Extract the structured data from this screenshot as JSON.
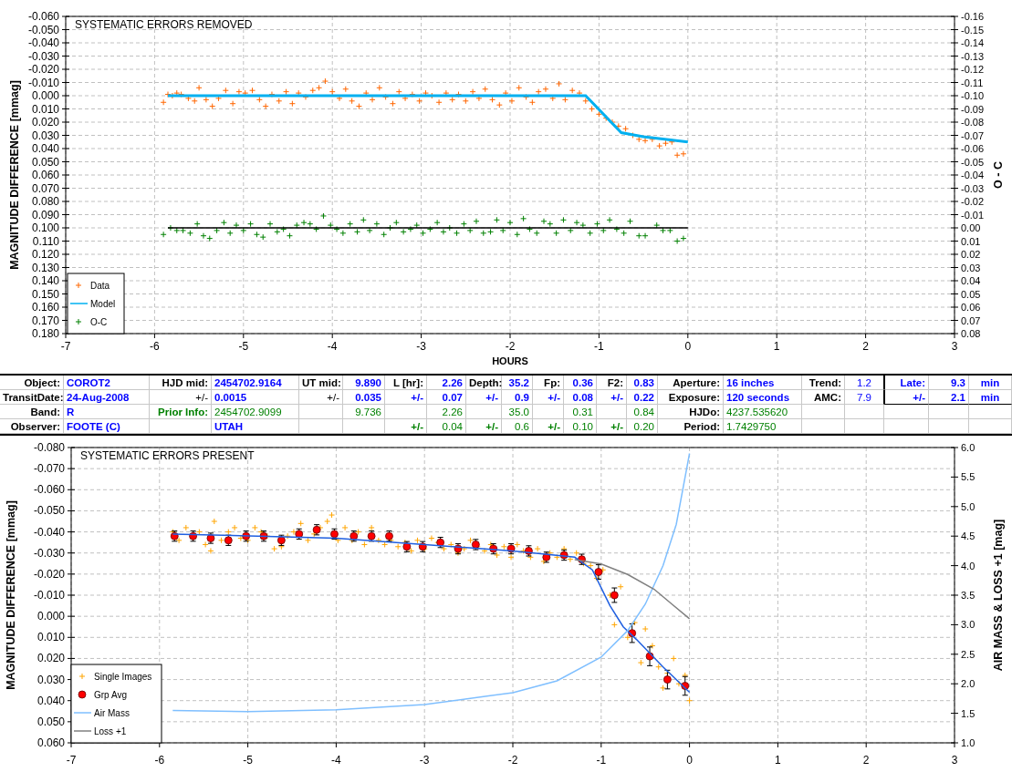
{
  "top_chart": {
    "chart_data": {
      "type": "scatter",
      "title": "SYSTEMATIC ERRORS REMOVED",
      "grid": true,
      "legend": true,
      "xlabel": "HOURS",
      "ylabel": "MAGNITUDE DIFFERENCE [mmag]",
      "y2label": "O - C",
      "xlim": [
        -7,
        3
      ],
      "ylim": [
        0.18,
        -0.06
      ],
      "y2lim": [
        0.08,
        -0.16
      ],
      "xticks": [
        {
          "value": -7,
          "label": "-7"
        },
        {
          "value": -6,
          "label": "-6"
        },
        {
          "value": -5,
          "label": "-5"
        },
        {
          "value": -4,
          "label": "-4"
        },
        {
          "value": -3,
          "label": "-3"
        },
        {
          "value": -2,
          "label": "-2"
        },
        {
          "value": -1,
          "label": "-1"
        },
        {
          "value": 0,
          "label": "0"
        },
        {
          "value": 1,
          "label": "1"
        },
        {
          "value": 2,
          "label": "2"
        },
        {
          "value": 3,
          "label": "3"
        }
      ],
      "yticks": [
        {
          "value": -0.06,
          "label": "-0.060"
        },
        {
          "value": -0.05,
          "label": "-0.050"
        },
        {
          "value": -0.04,
          "label": "-0.040"
        },
        {
          "value": -0.03,
          "label": "-0.030"
        },
        {
          "value": -0.02,
          "label": "-0.020"
        },
        {
          "value": -0.01,
          "label": "-0.010"
        },
        {
          "value": 0,
          "label": "0.000"
        },
        {
          "value": 0.01,
          "label": "0.010"
        },
        {
          "value": 0.02,
          "label": "0.020"
        },
        {
          "value": 0.03,
          "label": "0.030"
        },
        {
          "value": 0.04,
          "label": "0.040"
        },
        {
          "value": 0.05,
          "label": "0.050"
        },
        {
          "value": 0.06,
          "label": "0.060"
        },
        {
          "value": 0.07,
          "label": "0.070"
        },
        {
          "value": 0.08,
          "label": "0.080"
        },
        {
          "value": 0.09,
          "label": "0.090"
        },
        {
          "value": 0.1,
          "label": "0.100"
        },
        {
          "value": 0.11,
          "label": "0.110"
        },
        {
          "value": 0.12,
          "label": "0.120"
        },
        {
          "value": 0.13,
          "label": "0.130"
        },
        {
          "value": 0.14,
          "label": "0.140"
        },
        {
          "value": 0.15,
          "label": "0.150"
        },
        {
          "value": 0.16,
          "label": "0.160"
        },
        {
          "value": 0.17,
          "label": "0.170"
        },
        {
          "value": 0.18,
          "label": "0.180"
        }
      ],
      "y2ticks": [
        {
          "value": -0.16,
          "label": "-0.16"
        },
        {
          "value": -0.15,
          "label": "-0.15"
        },
        {
          "value": -0.14,
          "label": "-0.14"
        },
        {
          "value": -0.13,
          "label": "-0.13"
        },
        {
          "value": -0.12,
          "label": "-0.12"
        },
        {
          "value": -0.11,
          "label": "-0.11"
        },
        {
          "value": -0.1,
          "label": "-0.10"
        },
        {
          "value": -0.09,
          "label": "-0.09"
        },
        {
          "value": -0.08,
          "label": "-0.08"
        },
        {
          "value": -0.07,
          "label": "-0.07"
        },
        {
          "value": -0.06,
          "label": "-0.06"
        },
        {
          "value": -0.05,
          "label": "-0.05"
        },
        {
          "value": -0.04,
          "label": "-0.04"
        },
        {
          "value": -0.03,
          "label": "-0.03"
        },
        {
          "value": -0.02,
          "label": "-0.02"
        },
        {
          "value": -0.01,
          "label": "-0.01"
        },
        {
          "value": 0,
          "label": "0.00"
        },
        {
          "value": 0.01,
          "label": "0.01"
        },
        {
          "value": 0.02,
          "label": "0.02"
        },
        {
          "value": 0.03,
          "label": "0.03"
        },
        {
          "value": 0.04,
          "label": "0.04"
        },
        {
          "value": 0.05,
          "label": "0.05"
        },
        {
          "value": 0.06,
          "label": "0.06"
        },
        {
          "value": 0.07,
          "label": "0.07"
        },
        {
          "value": 0.08,
          "label": "0.08"
        }
      ],
      "series": [
        {
          "name": "Data",
          "type": "scatter",
          "marker": "plus",
          "color": "#ff6600",
          "x": [
            -5.9,
            -5.85,
            -5.8,
            -5.75,
            -5.7,
            -5.62,
            -5.55,
            -5.5,
            -5.42,
            -5.35,
            -5.28,
            -5.2,
            -5.12,
            -5.05,
            -4.98,
            -4.9,
            -4.82,
            -4.75,
            -4.68,
            -4.6,
            -4.52,
            -4.45,
            -4.38,
            -4.3,
            -4.22,
            -4.15,
            -4.08,
            -4.0,
            -3.92,
            -3.85,
            -3.78,
            -3.7,
            -3.62,
            -3.55,
            -3.47,
            -3.4,
            -3.32,
            -3.25,
            -3.18,
            -3.1,
            -3.02,
            -2.95,
            -2.88,
            -2.8,
            -2.72,
            -2.65,
            -2.58,
            -2.5,
            -2.42,
            -2.35,
            -2.28,
            -2.2,
            -2.12,
            -2.05,
            -1.98,
            -1.9,
            -1.82,
            -1.75,
            -1.68,
            -1.6,
            -1.52,
            -1.45,
            -1.38,
            -1.3,
            -1.22,
            -1.15,
            -1.08,
            -1.0,
            -0.92,
            -0.85,
            -0.78,
            -0.7,
            -0.62,
            -0.55,
            -0.48,
            -0.4,
            -0.32,
            -0.25,
            -0.18,
            -0.12,
            -0.05
          ],
          "values": [
            0.005,
            -0.001,
            0.0,
            -0.002,
            -0.001,
            0.002,
            0.004,
            -0.006,
            0.003,
            0.008,
            0.002,
            -0.004,
            0.006,
            -0.003,
            -0.002,
            -0.004,
            0.003,
            0.008,
            -0.001,
            0.004,
            -0.003,
            0.006,
            -0.002,
            0.001,
            -0.004,
            -0.006,
            -0.011,
            -0.003,
            0.002,
            -0.005,
            0.004,
            0.008,
            -0.002,
            0.003,
            -0.006,
            0.001,
            0.006,
            -0.003,
            0.002,
            -0.001,
            0.004,
            -0.002,
            0.0,
            0.005,
            -0.002,
            0.003,
            -0.001,
            0.004,
            -0.003,
            0.002,
            -0.005,
            0.003,
            0.007,
            -0.002,
            0.004,
            -0.006,
            0.001,
            0.005,
            -0.003,
            -0.005,
            0.002,
            -0.009,
            0.003,
            -0.004,
            -0.002,
            0.004,
            0.01,
            0.014,
            0.017,
            0.02,
            0.023,
            0.025,
            0.03,
            0.033,
            0.034,
            0.033,
            0.038,
            0.036,
            0.035,
            0.045,
            0.044
          ]
        },
        {
          "name": "Model",
          "type": "line",
          "color": "#00b0f0",
          "x": [
            -5.85,
            -1.15,
            -0.75,
            -0.5,
            0
          ],
          "values": [
            0.0,
            0.0,
            0.028,
            0.031,
            0.035
          ]
        },
        {
          "name": "O-C",
          "type": "scatter",
          "marker": "plus",
          "axis": "y2",
          "color": "#008000",
          "x": [
            -5.9,
            -5.82,
            -5.75,
            -5.68,
            -5.6,
            -5.52,
            -5.45,
            -5.38,
            -5.3,
            -5.22,
            -5.15,
            -5.08,
            -5.0,
            -4.92,
            -4.85,
            -4.78,
            -4.7,
            -4.62,
            -4.55,
            -4.48,
            -4.4,
            -4.32,
            -4.25,
            -4.18,
            -4.1,
            -4.02,
            -3.95,
            -3.88,
            -3.8,
            -3.72,
            -3.65,
            -3.58,
            -3.5,
            -3.42,
            -3.35,
            -3.28,
            -3.2,
            -3.12,
            -3.05,
            -2.98,
            -2.9,
            -2.82,
            -2.75,
            -2.68,
            -2.6,
            -2.52,
            -2.45,
            -2.38,
            -2.3,
            -2.22,
            -2.15,
            -2.08,
            -2.0,
            -1.92,
            -1.85,
            -1.78,
            -1.7,
            -1.62,
            -1.55,
            -1.48,
            -1.4,
            -1.32,
            -1.25,
            -1.18,
            -1.1,
            -1.02,
            -0.95,
            -0.88,
            -0.8,
            -0.72,
            -0.65,
            -0.55,
            -0.48,
            -0.35,
            -0.28,
            -0.2,
            -0.12,
            -0.05
          ],
          "values": [
            0.005,
            0.0,
            0.002,
            0.002,
            0.004,
            -0.003,
            0.006,
            0.008,
            0.002,
            -0.004,
            0.004,
            -0.002,
            0.002,
            -0.003,
            0.005,
            0.007,
            -0.003,
            0.003,
            0.001,
            0.006,
            -0.002,
            -0.004,
            -0.003,
            0.001,
            -0.009,
            -0.002,
            0.001,
            0.004,
            -0.003,
            0.003,
            -0.006,
            0.002,
            -0.003,
            0.005,
            0.0,
            -0.004,
            0.003,
            0.001,
            -0.002,
            0.004,
            0.001,
            -0.004,
            0.003,
            0.0,
            0.004,
            -0.003,
            0.002,
            -0.005,
            0.004,
            0.003,
            -0.006,
            0.002,
            -0.004,
            0.005,
            -0.007,
            0.001,
            0.004,
            -0.005,
            -0.003,
            0.004,
            -0.006,
            0.002,
            -0.004,
            -0.002,
            0.004,
            -0.003,
            0.002,
            -0.006,
            0.001,
            0.004,
            -0.005,
            0.006,
            0.006,
            -0.002,
            0.002,
            0.002,
            0.01,
            0.008
          ]
        },
        {
          "type": "line",
          "axis": "y2",
          "color": "#000000",
          "x": [
            -5.85,
            0
          ],
          "values": [
            0,
            0
          ]
        }
      ]
    }
  },
  "parameter_table": {
    "rows": [
      {
        "cells": [
          {
            "text": "Object:",
            "kind": "label"
          },
          {
            "text": "COROT2",
            "kind": "value"
          },
          {
            "text": "HJD mid:",
            "kind": "label"
          },
          {
            "text": "2454702.9164",
            "kind": "value"
          },
          {
            "text": "UT mid:",
            "kind": "label"
          },
          {
            "text": "9.890",
            "kind": "value"
          },
          {
            "text": "L [hr]:",
            "kind": "label"
          },
          {
            "text": "2.26",
            "kind": "value"
          },
          {
            "text": "Depth:",
            "kind": "label"
          },
          {
            "text": "35.2",
            "kind": "value"
          },
          {
            "text": "Fp:",
            "kind": "label"
          },
          {
            "text": "0.36",
            "kind": "value"
          },
          {
            "text": "F2:",
            "kind": "label"
          },
          {
            "text": "0.83",
            "kind": "value"
          },
          {
            "text": "Aperture:",
            "kind": "label"
          },
          {
            "text": "16 inches",
            "kind": "value"
          },
          {
            "text": "Trend:",
            "kind": "label"
          },
          {
            "text": "1.2",
            "kind": "setting"
          },
          {
            "text": "Late:",
            "kind": "value"
          },
          {
            "text": "9.3",
            "kind": "value"
          },
          {
            "text": "min",
            "kind": "value"
          }
        ]
      },
      {
        "cells": [
          {
            "text": "TransitDate:",
            "kind": "label"
          },
          {
            "text": "24-Aug-2008",
            "kind": "value"
          },
          {
            "text": "+/-",
            "kind": "plain"
          },
          {
            "text": "0.0015",
            "kind": "value"
          },
          {
            "text": "+/-",
            "kind": "plain"
          },
          {
            "text": "0.035",
            "kind": "value"
          },
          {
            "text": "+/-",
            "kind": "value"
          },
          {
            "text": "0.07",
            "kind": "value"
          },
          {
            "text": "+/-",
            "kind": "value"
          },
          {
            "text": "0.9",
            "kind": "value"
          },
          {
            "text": "+/-",
            "kind": "value"
          },
          {
            "text": "0.08",
            "kind": "value"
          },
          {
            "text": "+/-",
            "kind": "value"
          },
          {
            "text": "0.22",
            "kind": "value"
          },
          {
            "text": "Exposure:",
            "kind": "label"
          },
          {
            "text": "120 seconds",
            "kind": "value"
          },
          {
            "text": "AMC:",
            "kind": "label"
          },
          {
            "text": "7.9",
            "kind": "setting"
          },
          {
            "text": "+/-",
            "kind": "value"
          },
          {
            "text": "2.1",
            "kind": "value"
          },
          {
            "text": "min",
            "kind": "value"
          }
        ]
      },
      {
        "cells": [
          {
            "text": "Band:",
            "kind": "label"
          },
          {
            "text": "R",
            "kind": "value"
          },
          {
            "text": "Prior Info:",
            "kind": "prior-label"
          },
          {
            "text": "2454702.9099",
            "kind": "prior"
          },
          null,
          {
            "text": "9.736",
            "kind": "prior"
          },
          null,
          {
            "text": "2.26",
            "kind": "prior"
          },
          null,
          {
            "text": "35.0",
            "kind": "prior"
          },
          null,
          {
            "text": "0.31",
            "kind": "prior"
          },
          null,
          {
            "text": "0.84",
            "kind": "prior"
          },
          {
            "text": "HJDo:",
            "kind": "label"
          },
          {
            "text": "4237.535620",
            "kind": "prior"
          },
          null,
          null,
          null,
          null,
          null
        ]
      },
      {
        "cells": [
          {
            "text": "Observer:",
            "kind": "label"
          },
          {
            "text": "FOOTE (C)",
            "kind": "value"
          },
          null,
          {
            "text": "UTAH",
            "kind": "value"
          },
          null,
          null,
          {
            "text": "+/-",
            "kind": "prior-label"
          },
          {
            "text": "0.04",
            "kind": "prior"
          },
          {
            "text": "+/-",
            "kind": "prior-label"
          },
          {
            "text": "0.6",
            "kind": "prior"
          },
          {
            "text": "+/-",
            "kind": "prior-label"
          },
          {
            "text": "0.10",
            "kind": "prior"
          },
          {
            "text": "+/-",
            "kind": "prior-label"
          },
          {
            "text": "0.20",
            "kind": "prior"
          },
          {
            "text": "Period:",
            "kind": "label"
          },
          {
            "text": "1.7429750",
            "kind": "prior"
          },
          null,
          null,
          null,
          null,
          null
        ]
      }
    ]
  },
  "bottom_chart": {
    "chart_data": {
      "type": "scatter",
      "title": "SYSTEMATIC ERRORS PRESENT",
      "grid": true,
      "legend": true,
      "ylabel": "MAGNITUDE DIFFERENCE [mmag]",
      "y2label": "AIR MASS & LOSS +1 [mag]",
      "xlim": [
        -7,
        3
      ],
      "ylim": [
        0.06,
        -0.08
      ],
      "y2lim": [
        1,
        6
      ],
      "xticks": [
        {
          "value": -7,
          "label": "-7"
        },
        {
          "value": -6,
          "label": "-6"
        },
        {
          "value": -5,
          "label": "-5"
        },
        {
          "value": -4,
          "label": "-4"
        },
        {
          "value": -3,
          "label": "-3"
        },
        {
          "value": -2,
          "label": "-2"
        },
        {
          "value": -1,
          "label": "-1"
        },
        {
          "value": 0,
          "label": "0"
        },
        {
          "value": 1,
          "label": "1"
        },
        {
          "value": 2,
          "label": "2"
        },
        {
          "value": 3,
          "label": "3"
        }
      ],
      "yticks": [
        {
          "value": -0.08,
          "label": "-0.080"
        },
        {
          "value": -0.07,
          "label": "-0.070"
        },
        {
          "value": -0.06,
          "label": "-0.060"
        },
        {
          "value": -0.05,
          "label": "-0.050"
        },
        {
          "value": -0.04,
          "label": "-0.040"
        },
        {
          "value": -0.03,
          "label": "-0.030"
        },
        {
          "value": -0.02,
          "label": "-0.020"
        },
        {
          "value": -0.01,
          "label": "-0.010"
        },
        {
          "value": 0,
          "label": "0.000"
        },
        {
          "value": 0.01,
          "label": "0.010"
        },
        {
          "value": 0.02,
          "label": "0.020"
        },
        {
          "value": 0.03,
          "label": "0.030"
        },
        {
          "value": 0.04,
          "label": "0.040"
        },
        {
          "value": 0.05,
          "label": "0.050"
        },
        {
          "value": 0.06,
          "label": "0.060"
        }
      ],
      "y2ticks": [
        {
          "value": 6,
          "label": "6.0"
        },
        {
          "value": 5.5,
          "label": "5.5"
        },
        {
          "value": 5,
          "label": "5.0"
        },
        {
          "value": 4.5,
          "label": "4.5"
        },
        {
          "value": 4,
          "label": "4.0"
        },
        {
          "value": 3.5,
          "label": "3.5"
        },
        {
          "value": 3,
          "label": "3.0"
        },
        {
          "value": 2.5,
          "label": "2.5"
        },
        {
          "value": 2,
          "label": "2.0"
        },
        {
          "value": 1.5,
          "label": "1.5"
        },
        {
          "value": 1,
          "label": "1.0"
        }
      ],
      "series": [
        {
          "name": "Single Images",
          "type": "scatter",
          "marker": "plus",
          "color": "#ffa500",
          "x": [
            -5.85,
            -5.78,
            -5.7,
            -5.62,
            -5.55,
            -5.48,
            -5.42,
            -5.38,
            -5.3,
            -5.22,
            -5.15,
            -5.08,
            -5.0,
            -4.92,
            -4.85,
            -4.78,
            -4.7,
            -4.62,
            -4.55,
            -4.48,
            -4.4,
            -4.32,
            -4.25,
            -4.18,
            -4.1,
            -4.05,
            -3.98,
            -3.9,
            -3.82,
            -3.75,
            -3.68,
            -3.6,
            -3.52,
            -3.45,
            -3.38,
            -3.3,
            -3.22,
            -3.15,
            -3.08,
            -3.0,
            -2.92,
            -2.85,
            -2.78,
            -2.7,
            -2.62,
            -2.55,
            -2.48,
            -2.4,
            -2.32,
            -2.25,
            -2.18,
            -2.1,
            -2.02,
            -1.95,
            -1.88,
            -1.8,
            -1.72,
            -1.65,
            -1.58,
            -1.5,
            -1.42,
            -1.35,
            -1.28,
            -1.2,
            -1.12,
            -1.05,
            -0.98,
            -0.9,
            -0.85,
            -0.78,
            -0.7,
            -0.62,
            -0.55,
            -0.5,
            -0.42,
            -0.35,
            -0.3,
            -0.25,
            -0.18,
            -0.12,
            -0.05,
            0.0
          ],
          "values": [
            -0.04,
            -0.036,
            -0.042,
            -0.037,
            -0.04,
            -0.034,
            -0.031,
            -0.045,
            -0.036,
            -0.04,
            -0.042,
            -0.037,
            -0.036,
            -0.042,
            -0.04,
            -0.038,
            -0.032,
            -0.033,
            -0.038,
            -0.04,
            -0.044,
            -0.036,
            -0.039,
            -0.042,
            -0.045,
            -0.048,
            -0.036,
            -0.042,
            -0.036,
            -0.04,
            -0.034,
            -0.042,
            -0.036,
            -0.034,
            -0.036,
            -0.033,
            -0.035,
            -0.031,
            -0.036,
            -0.032,
            -0.037,
            -0.035,
            -0.032,
            -0.034,
            -0.03,
            -0.032,
            -0.036,
            -0.033,
            -0.031,
            -0.034,
            -0.029,
            -0.033,
            -0.028,
            -0.034,
            -0.031,
            -0.028,
            -0.032,
            -0.026,
            -0.03,
            -0.028,
            -0.032,
            -0.027,
            -0.03,
            -0.025,
            -0.024,
            -0.018,
            -0.022,
            -0.01,
            0.004,
            -0.014,
            0.01,
            0.003,
            0.022,
            0.006,
            0.014,
            0.024,
            0.034,
            0.027,
            0.02,
            0.032,
            0.028,
            0.04
          ]
        },
        {
          "name": "Grp Avg",
          "type": "scatter",
          "marker": "circle",
          "color": "#ff0000",
          "x": [
            -5.83,
            -5.62,
            -5.42,
            -5.22,
            -5.02,
            -4.82,
            -4.62,
            -4.42,
            -4.22,
            -4.02,
            -3.8,
            -3.6,
            -3.4,
            -3.2,
            -3.02,
            -2.82,
            -2.62,
            -2.42,
            -2.22,
            -2.02,
            -1.82,
            -1.62,
            -1.42,
            -1.22,
            -1.03,
            -0.85,
            -0.65,
            -0.45,
            -0.25,
            -0.05
          ],
          "values": [
            -0.038,
            -0.038,
            -0.037,
            -0.036,
            -0.038,
            -0.038,
            -0.036,
            -0.039,
            -0.041,
            -0.039,
            -0.038,
            -0.038,
            -0.038,
            -0.033,
            -0.033,
            -0.035,
            -0.032,
            -0.034,
            -0.032,
            -0.032,
            -0.031,
            -0.028,
            -0.029,
            -0.027,
            -0.021,
            -0.01,
            0.008,
            0.019,
            0.03,
            0.033
          ],
          "errors": [
            0.002,
            0.002,
            0.002,
            0.002,
            0.002,
            0.002,
            0.002,
            0.002,
            0.002,
            0.002,
            0.002,
            0.002,
            0.002,
            0.002,
            0.002,
            0.002,
            0.002,
            0.002,
            0.002,
            0.002,
            0.002,
            0.002,
            0.002,
            0.002,
            0.003,
            0.003,
            0.004,
            0.004,
            0.004,
            0.004
          ]
        },
        {
          "type": "line",
          "color": "#1f5fe0",
          "x": [
            -5.85,
            -4,
            -3,
            -2,
            -1.3,
            -1.1,
            -0.9,
            -0.75,
            -0.6,
            -0.3,
            0
          ],
          "values": [
            -0.039,
            -0.037,
            -0.034,
            -0.031,
            -0.028,
            -0.022,
            -0.005,
            0.005,
            0.011,
            0.024,
            0.036
          ]
        },
        {
          "name": "Air Mass",
          "type": "line",
          "axis": "y2",
          "color": "#7fbfff",
          "x": [
            -5.85,
            -5,
            -4,
            -3,
            -2,
            -1.5,
            -1,
            -0.7,
            -0.5,
            -0.3,
            -0.15,
            0
          ],
          "values": [
            1.55,
            1.53,
            1.56,
            1.65,
            1.85,
            2.05,
            2.45,
            2.9,
            3.35,
            4.0,
            4.7,
            5.9
          ]
        },
        {
          "name": "Loss +1",
          "type": "line",
          "axis": "y2",
          "color": "#808080",
          "x": [
            -1.3,
            -1,
            -0.7,
            -0.4,
            -0.2,
            0
          ],
          "values": [
            4.1,
            4.03,
            3.85,
            3.6,
            3.35,
            3.1
          ]
        }
      ]
    }
  }
}
